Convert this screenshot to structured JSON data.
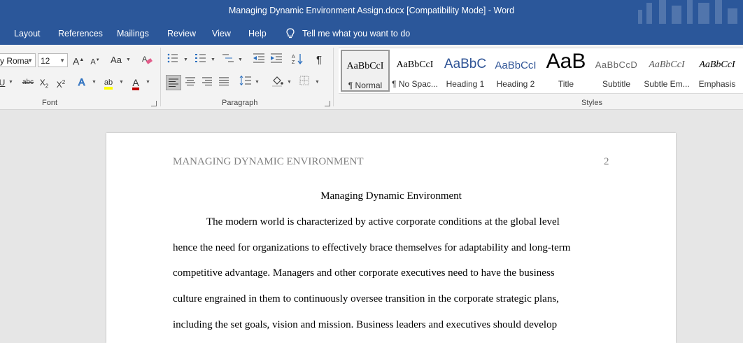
{
  "window": {
    "title": "Managing Dynamic Environment Assign.docx [Compatibility Mode]  -  Word"
  },
  "tabs": [
    "Layout",
    "References",
    "Mailings",
    "Review",
    "View",
    "Help"
  ],
  "tell_me": {
    "text": "Tell me what you want to do",
    "icon": "lightbulb-icon"
  },
  "font_group": {
    "label": "Font",
    "font_name": "y Roma",
    "font_size": "12",
    "change_case": "Aa",
    "underline": "U",
    "strikethrough": "abc",
    "subscript": "X",
    "subscript_mark": "2",
    "superscript": "X",
    "superscript_mark": "2",
    "grow_font": "A",
    "shrink_font": "A",
    "font_color_letter": "A",
    "highlight_letter": "ab",
    "font_color": "#c00000",
    "highlight_color": "#ffff00"
  },
  "paragraph_group": {
    "label": "Paragraph",
    "pilcrow": "¶"
  },
  "styles_group": {
    "label": "Styles",
    "items": [
      {
        "sample": "AaBbCcI",
        "name": "¶ Normal",
        "selected": true
      },
      {
        "sample": "AaBbCcI",
        "name": "¶ No Spac..."
      },
      {
        "sample": "AaBbC",
        "name": "Heading 1"
      },
      {
        "sample": "AaBbCcI",
        "name": "Heading 2"
      },
      {
        "sample": "AaB",
        "name": "Title"
      },
      {
        "sample": "AaBbCcD",
        "name": "Subtitle"
      },
      {
        "sample": "AaBbCcI",
        "name": "Subtle Em..."
      },
      {
        "sample": "AaBbCcI",
        "name": "Emphasis"
      }
    ]
  },
  "document": {
    "running_head": "MANAGING DYNAMIC ENVIRONMENT",
    "page_number": "2",
    "heading": "Managing Dynamic Environment",
    "lines": [
      "The modern world is characterized by active corporate conditions at the global level",
      "hence the need for organizations to effectively brace themselves for adaptability and long-term",
      "competitive advantage. Managers and other corporate executives need to have the business",
      "culture engrained in them to continuously oversee transition in the corporate strategic plans,",
      "including the set goals, vision and mission. Business leaders and executives should develop"
    ]
  }
}
